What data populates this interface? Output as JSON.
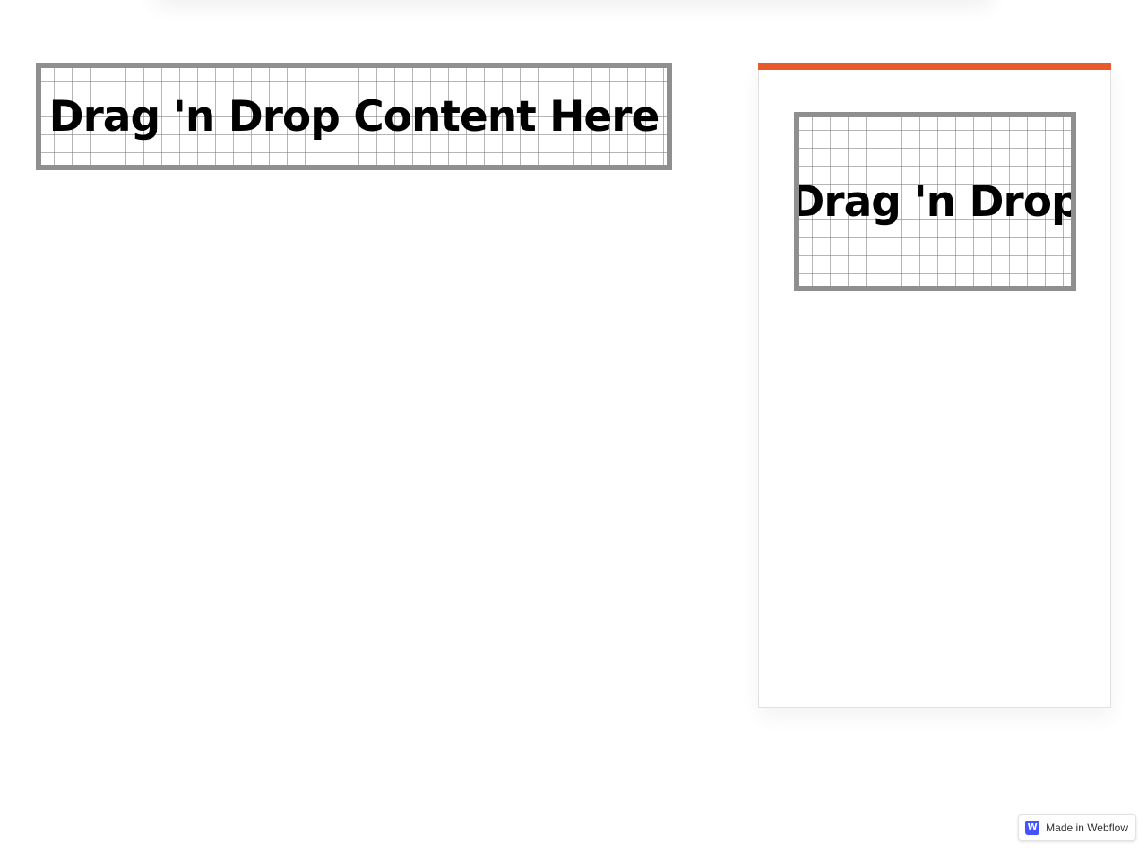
{
  "main": {
    "dropzone_label": "Drag 'n Drop Content Here"
  },
  "sidebar": {
    "dropzone_label": "Drag 'n Drop",
    "accent_color": "#e85a2a"
  },
  "badge": {
    "icon_glyph": "W",
    "icon": "webflow-logo-icon",
    "label": "Made in Webflow",
    "icon_color": "#4353ff"
  }
}
